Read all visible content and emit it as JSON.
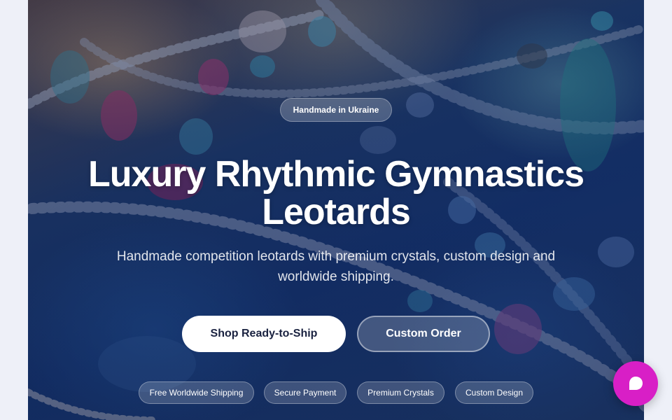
{
  "hero": {
    "badge": "Handmade in Ukraine",
    "title_line1": "Luxury Rhythmic Gymnastics",
    "title_line2": "Leotards",
    "subtitle_line1": "Handmade competition leotards with premium crystals, custom design and",
    "subtitle_line2": "worldwide shipping.",
    "primary_cta": "Shop Ready-to-Ship",
    "secondary_cta": "Custom Order",
    "features": [
      "Free Worldwide Shipping",
      "Secure Payment",
      "Premium Crystals",
      "Custom Design"
    ],
    "background_image": "crystal-jewelry-photo"
  },
  "chat": {
    "icon": "chat-bubble-icon",
    "color": "#d81fc6"
  },
  "colors": {
    "page_background": "#eef0f8",
    "primary_button_bg": "#ffffff",
    "primary_button_text": "#1a2240"
  }
}
